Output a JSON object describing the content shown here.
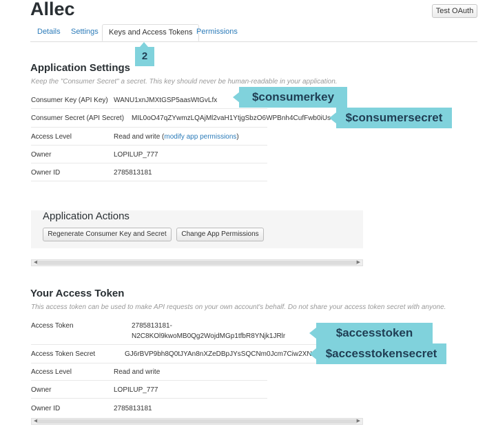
{
  "header": {
    "app_name": "Allec",
    "test_oauth_label": "Test OAuth"
  },
  "tabs": [
    {
      "label": "Details"
    },
    {
      "label": "Settings"
    },
    {
      "label": "Keys and Access Tokens"
    },
    {
      "label": "Permissions"
    }
  ],
  "callouts": {
    "step": "2",
    "consumerkey": "$consumerkey",
    "consumersecret": "$consumersecret",
    "accesstoken": "$accesstoken",
    "accesstokensecret": "$accesstokensecret"
  },
  "app_settings": {
    "title": "Application Settings",
    "note": "Keep the \"Consumer Secret\" a secret. This key should never be human-readable in your application.",
    "consumer_key_label": "Consumer Key (API Key)",
    "consumer_key": "WANU1xnJMXtGSP5aasWtGvLfx",
    "consumer_secret_label": "Consumer Secret (API Secret)",
    "consumer_secret": "MIL0oO47qZYwmzLQAjMl2vaH1YtjgSbzO6WPBnh4CufFwb0iUs",
    "access_level_label": "Access Level",
    "access_level": "Read and write (",
    "access_level_link": "modify app permissions",
    "access_level_end": ")",
    "owner_label": "Owner",
    "owner": "LOPILUP_777",
    "owner_id_label": "Owner ID",
    "owner_id": "2785813181"
  },
  "app_actions": {
    "title": "Application Actions",
    "regenerate_label": "Regenerate Consumer Key and Secret",
    "change_permissions_label": "Change App Permissions"
  },
  "access_token": {
    "title": "Your Access Token",
    "note": "This access token can be used to make API requests on your own account's behalf. Do not share your access token secret with anyone.",
    "token_label": "Access Token",
    "token_line1": "2785813181-",
    "token_line2": "N2C8KOl9kwoMB0Qg2WojdMGp1tfbR8YNjk1JRlr",
    "secret_label": "Access Token Secret",
    "secret": "GJ6rBVP9bh8Q0tJYAn8nXZeDBpJYsSQCNm0Jcm7Ciw2XN",
    "access_level_label": "Access Level",
    "access_level": "Read and write",
    "owner_label": "Owner",
    "owner": "LOPILUP_777",
    "owner_id_label": "Owner ID",
    "owner_id": "2785813181"
  }
}
